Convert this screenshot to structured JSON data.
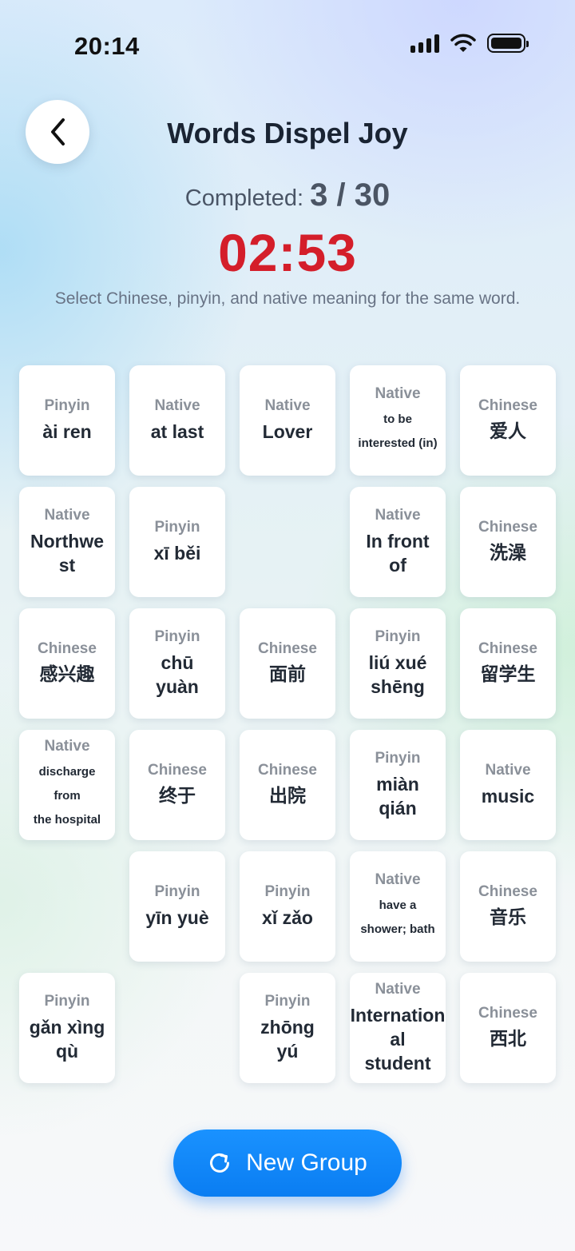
{
  "status_bar": {
    "time": "20:14"
  },
  "header": {
    "title": "Words Dispel Joy",
    "completed_label": "Completed: ",
    "completed_value": "3 / 30",
    "timer": "02:53",
    "instructions": "Select Chinese, pinyin, and native meaning for the same word."
  },
  "cards": [
    {
      "category": "Pinyin",
      "lines": [
        "ài ren"
      ]
    },
    {
      "category": "Native",
      "lines": [
        "at last"
      ]
    },
    {
      "category": "Native",
      "lines": [
        "Lover"
      ]
    },
    {
      "category": "Native",
      "lines": [
        "to be",
        "interested (in)"
      ],
      "small": true
    },
    {
      "category": "Chinese",
      "lines": [
        "爱人"
      ]
    },
    {
      "category": "Native",
      "lines": [
        "Northwe",
        "st"
      ]
    },
    {
      "category": "Pinyin",
      "lines": [
        "xī běi"
      ]
    },
    {
      "category": "Native",
      "lines": [
        "In front",
        "of"
      ]
    },
    {
      "category": "Chinese",
      "lines": [
        "洗澡"
      ]
    },
    {
      "category": "Chinese",
      "lines": [
        "感兴趣"
      ]
    },
    {
      "category": "Pinyin",
      "lines": [
        "chū",
        "yuàn"
      ]
    },
    {
      "category": "Chinese",
      "lines": [
        "面前"
      ]
    },
    {
      "category": "Pinyin",
      "lines": [
        "liú xué",
        "shēng"
      ]
    },
    {
      "category": "Chinese",
      "lines": [
        "留学生"
      ]
    },
    {
      "category": "Native",
      "lines": [
        "discharge from",
        "the hospital"
      ],
      "small": true
    },
    {
      "category": "Chinese",
      "lines": [
        "终于"
      ]
    },
    {
      "category": "Chinese",
      "lines": [
        "出院"
      ]
    },
    {
      "category": "Pinyin",
      "lines": [
        "miàn",
        "qián"
      ]
    },
    {
      "category": "Native",
      "lines": [
        "music"
      ]
    },
    {
      "category": "Pinyin",
      "lines": [
        "yīn yuè"
      ]
    },
    {
      "category": "Pinyin",
      "lines": [
        "xǐ zǎo"
      ]
    },
    {
      "category": "Native",
      "lines": [
        "have a",
        "shower; bath"
      ],
      "small": true
    },
    {
      "category": "Chinese",
      "lines": [
        "音乐"
      ]
    },
    {
      "category": "Pinyin",
      "lines": [
        "gǎn xìng",
        "qù"
      ]
    },
    {
      "category": "Pinyin",
      "lines": [
        "zhōng",
        "yú"
      ]
    },
    {
      "category": "Native",
      "lines": [
        "Internation",
        "al student"
      ]
    },
    {
      "category": "Chinese",
      "lines": [
        "西北"
      ]
    }
  ],
  "new_group_button": {
    "label": "New Group"
  },
  "colors": {
    "accent": "#0a84ff",
    "timer": "#d41e2a"
  }
}
